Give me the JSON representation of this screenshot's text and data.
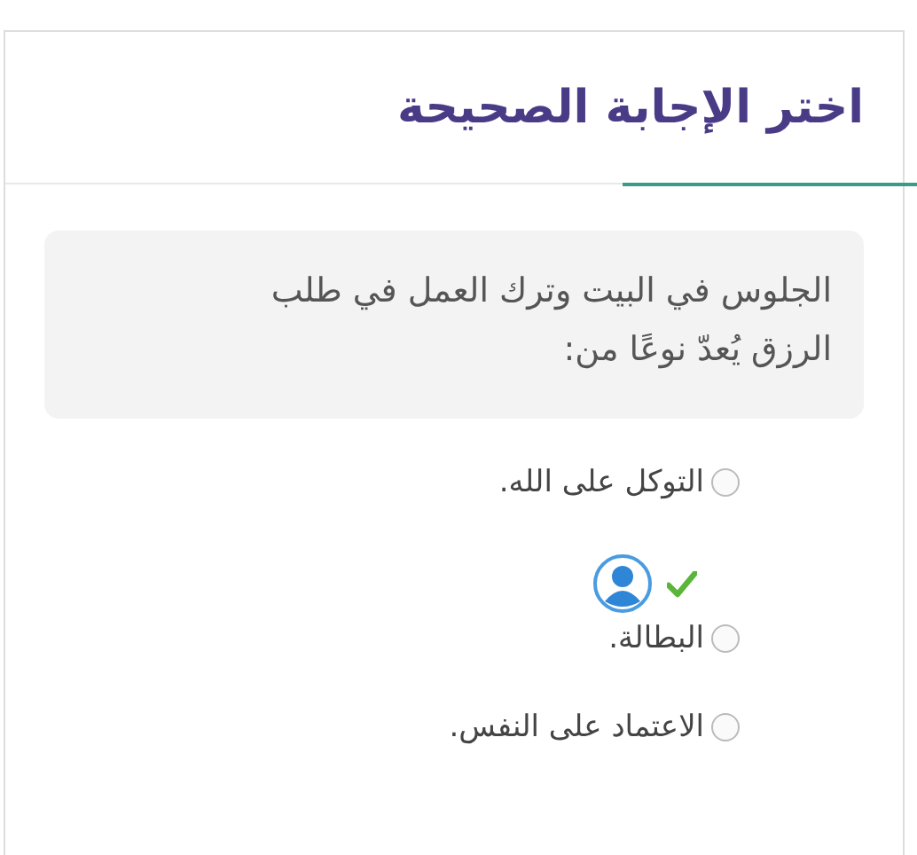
{
  "title": "اختر الإجابة الصحيحة",
  "question": "الجلوس في البيت وترك العمل في طلب الرزق يُعدّ نوعًا من:",
  "options": [
    {
      "label": "التوكل على الله.",
      "selected": false,
      "user_choice": false,
      "correct": false
    },
    {
      "label": "البطالة.",
      "selected": false,
      "user_choice": true,
      "correct": true
    },
    {
      "label": "الاعتماد على النفس.",
      "selected": false,
      "user_choice": false,
      "correct": false
    }
  ]
}
